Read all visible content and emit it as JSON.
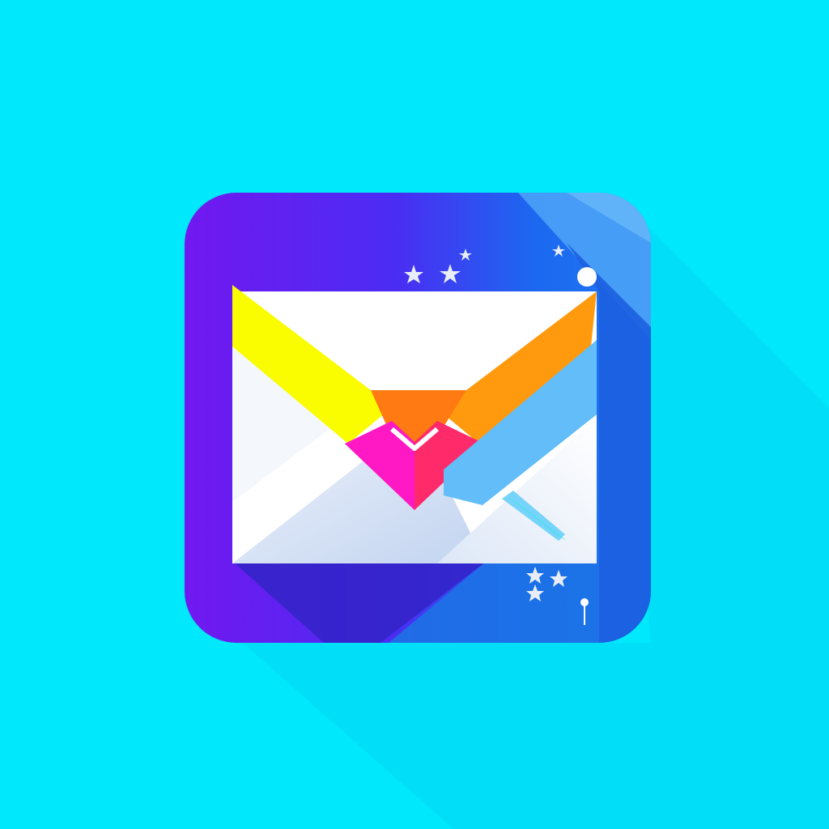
{
  "app_icon": {
    "icon": "mail-envelope-icon",
    "colors": {
      "background": "#00e8fb",
      "tile_purple": "#6e17f2",
      "tile_blue": "#1f6cf0",
      "tile_light_blue": "#58b0fb",
      "envelope_white": "#ffffff",
      "flap_yellow": "#fafc00",
      "flap_orange": "#ff9a0e",
      "heart_pink": "#ff16b2",
      "accent_sky": "#62bdf9",
      "sparkle": "#e8edf8"
    },
    "decorations": [
      "sparkle-star-icon",
      "sparkle-dot-icon",
      "pin-icon"
    ]
  }
}
